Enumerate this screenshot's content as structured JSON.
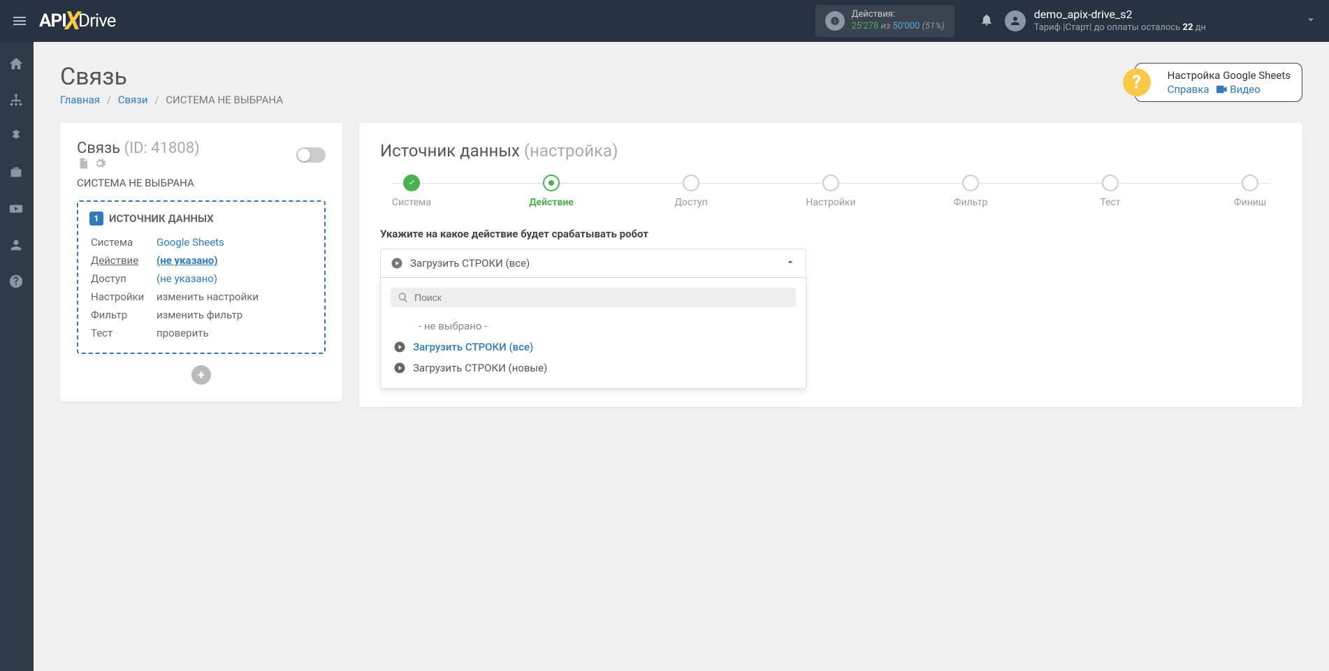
{
  "header": {
    "actions_label": "Действия:",
    "used": "25'278",
    "sep": "из",
    "total": "50'000",
    "pct": "(51%)",
    "user_name": "demo_apix-drive_s2",
    "tariff_prefix": "Тариф |Старт| до оплаты осталось ",
    "tariff_days": "22",
    "tariff_suffix": " дн"
  },
  "page": {
    "title": "Связь",
    "crumb_home": "Главная",
    "crumb_links": "Связи",
    "crumb_current": "СИСТЕМА НЕ ВЫБРАНА"
  },
  "help": {
    "title": "Настройка Google Sheets",
    "help_link": "Справка",
    "video_link": "Видео"
  },
  "left": {
    "title": "Связь",
    "id": "(ID: 41808)",
    "subtitle": "СИСТЕМА НЕ ВЫБРАНА",
    "source_num": "1",
    "source_title": "ИСТОЧНИК ДАННЫХ",
    "rows": {
      "system_label": "Система",
      "system_value": "Google Sheets",
      "action_label": "Действие",
      "action_value": "(не указано)",
      "access_label": "Доступ",
      "access_value": "(не указано)",
      "settings_label": "Настройки",
      "settings_value": "изменить настройки",
      "filter_label": "Фильтр",
      "filter_value": "изменить фильтр",
      "test_label": "Тест",
      "test_value": "проверить"
    }
  },
  "right": {
    "title_main": "Источник данных",
    "title_sub": "(настройка)",
    "steps": {
      "s1": "Система",
      "s2": "Действие",
      "s3": "Доступ",
      "s4": "Настройки",
      "s5": "Фильтр",
      "s6": "Тест",
      "s7": "Финиш"
    },
    "instruction": "Укажите на какое действие будет срабатывать робот",
    "dropdown": {
      "selected": "Загрузить СТРОКИ (все)",
      "search_placeholder": "Поиск",
      "opt_none": "- не выбрано -",
      "opt_all": "Загрузить СТРОКИ (все)",
      "opt_new": "Загрузить СТРОКИ (новые)"
    }
  }
}
